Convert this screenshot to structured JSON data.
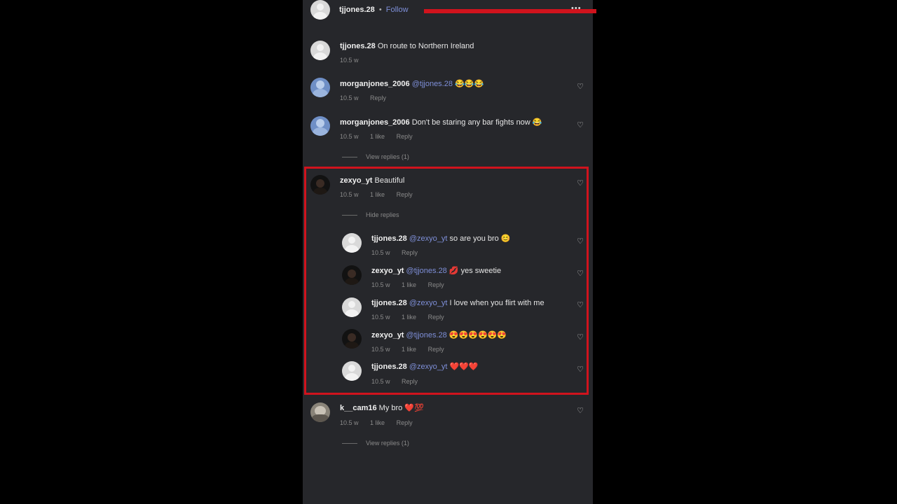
{
  "header": {
    "username": "tjjones.28",
    "separator": "•",
    "follow_label": "Follow",
    "more_icon": "more-icon",
    "more_glyph": "•••"
  },
  "caption": {
    "username": "tjjones.28",
    "text": "On route to Northern Ireland",
    "time": "10.5 w"
  },
  "comments": [
    {
      "username": "morganjones_2006",
      "mention": "@tjjones.28",
      "text": "😂😂😂",
      "time": "10.5 w",
      "likes": "",
      "reply_label": "Reply"
    },
    {
      "username": "morganjones_2006",
      "text": "Don't be staring any bar fights now 😂",
      "time": "10.5 w",
      "likes": "1 like",
      "reply_label": "Reply",
      "view_replies": "View replies (1)"
    },
    {
      "username": "zexyo_yt",
      "text": "Beautiful",
      "time": "10.5 w",
      "likes": "1 like",
      "reply_label": "Reply",
      "hide_replies": "Hide replies",
      "replies": [
        {
          "username": "tjjones.28",
          "mention": "@zexyo_yt",
          "text": "so are you bro 😊",
          "time": "10.5 w",
          "likes": "",
          "reply_label": "Reply"
        },
        {
          "username": "zexyo_yt",
          "mention": "@tjjones.28",
          "text": "💋 yes sweetie",
          "time": "10.5 w",
          "likes": "1 like",
          "reply_label": "Reply"
        },
        {
          "username": "tjjones.28",
          "mention": "@zexyo_yt",
          "text": "I love when you flirt with me",
          "time": "10.5 w",
          "likes": "1 like",
          "reply_label": "Reply"
        },
        {
          "username": "zexyo_yt",
          "mention": "@tjjones.28",
          "text": "😍😍😍😍😍😍",
          "time": "10.5 w",
          "likes": "1 like",
          "reply_label": "Reply"
        },
        {
          "username": "tjjones.28",
          "mention": "@zexyo_yt",
          "text": "❤️❤️❤️",
          "time": "10.5 w",
          "likes": "",
          "reply_label": "Reply"
        }
      ]
    },
    {
      "username": "k__cam16",
      "text": "My bro ❤️💯",
      "time": "10.5 w",
      "likes": "1 like",
      "reply_label": "Reply",
      "view_replies": "View replies (1)"
    }
  ],
  "colors": {
    "background": "#26272b",
    "mention": "#7e8fd8",
    "highlight": "#d0131d"
  }
}
